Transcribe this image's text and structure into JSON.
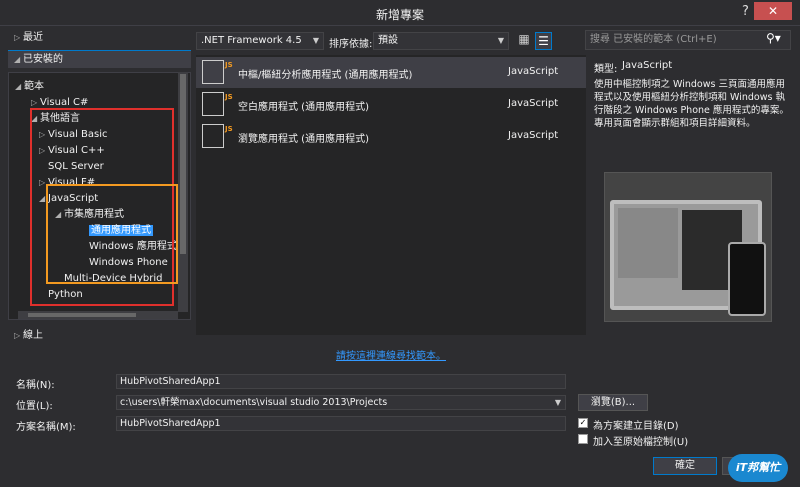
{
  "window": {
    "title": "新增專案",
    "help": "?",
    "close": "✕"
  },
  "sidebar": {
    "recent": "最近",
    "installed": "已安裝的",
    "online": "線上",
    "tree": [
      {
        "label": "範本",
        "arrow": "◢",
        "level": 0
      },
      {
        "label": "Visual C#",
        "arrow": "▷",
        "level": 1
      },
      {
        "label": "其他語言",
        "arrow": "◢",
        "level": 1
      },
      {
        "label": "Visual Basic",
        "arrow": "▷",
        "level": 2
      },
      {
        "label": "Visual C++",
        "arrow": "▷",
        "level": 2
      },
      {
        "label": "SQL Server",
        "arrow": "",
        "level": 2
      },
      {
        "label": "Visual F#",
        "arrow": "▷",
        "level": 2
      },
      {
        "label": "JavaScript",
        "arrow": "◢",
        "level": 2
      },
      {
        "label": "市集應用程式",
        "arrow": "◢",
        "level": 3
      },
      {
        "label": "通用應用程式",
        "arrow": "",
        "level": 4
      },
      {
        "label": "Windows 應用程式",
        "arrow": "",
        "level": 4
      },
      {
        "label": "Windows Phone",
        "arrow": "",
        "level": 4
      },
      {
        "label": "Multi-Device Hybrid",
        "arrow": "",
        "level": 3
      },
      {
        "label": "Python",
        "arrow": "",
        "level": 2
      }
    ]
  },
  "toolbar": {
    "framework": ".NET Framework 4.5",
    "sort_label": "排序依據:",
    "sort_value": "預設",
    "grid_icon": "grid-view-icon",
    "list_icon": "list-view-icon"
  },
  "templates": [
    {
      "name": "中樞/樞紐分析應用程式 (通用應用程式)",
      "lang": "JavaScript"
    },
    {
      "name": "空白應用程式 (通用應用程式)",
      "lang": "JavaScript"
    },
    {
      "name": "瀏覽應用程式 (通用應用程式)",
      "lang": "JavaScript"
    }
  ],
  "template_badge": "JS",
  "search": {
    "placeholder": "搜尋 已安裝的範本 (Ctrl+E)"
  },
  "details": {
    "type_label": "類型:",
    "type_value": "JavaScript",
    "description": "使用中樞控制項之 Windows 三頁面通用應用程式以及使用樞紐分析控制項和 Windows 執行階段之 Windows Phone 應用程式的專案。專用頁面會顯示群組和項目詳細資料。"
  },
  "link": "請按這裡連線尋找範本。",
  "form": {
    "name_label": "名稱(N):",
    "name_value": "HubPivotSharedApp1",
    "location_label": "位置(L):",
    "location_value": "c:\\users\\軒榮max\\documents\\visual studio 2013\\Projects",
    "solution_label": "方案名稱(M):",
    "solution_value": "HubPivotSharedApp1",
    "browse": "瀏覽(B)...",
    "create_dir": "為方案建立目錄(D)",
    "create_dir_checked": true,
    "source_control": "加入至原始檔控制(U)",
    "ok": "確定"
  },
  "watermark": "iT邦幫忙"
}
